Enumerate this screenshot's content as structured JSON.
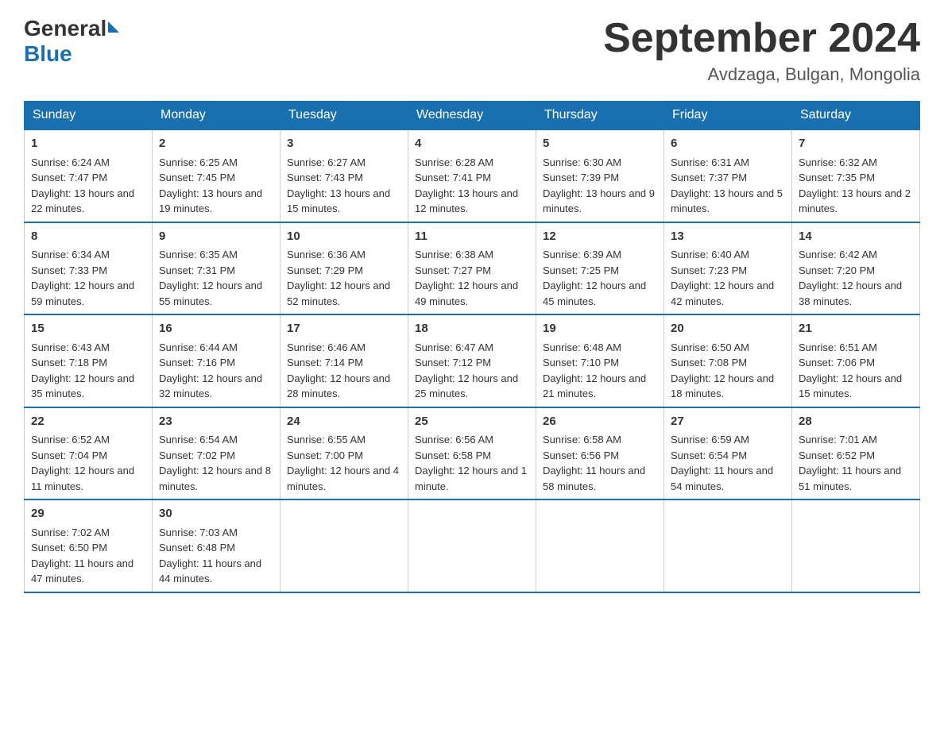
{
  "logo": {
    "general": "General",
    "blue": "Blue"
  },
  "title": "September 2024",
  "location": "Avdzaga, Bulgan, Mongolia",
  "days_of_week": [
    "Sunday",
    "Monday",
    "Tuesday",
    "Wednesday",
    "Thursday",
    "Friday",
    "Saturday"
  ],
  "weeks": [
    [
      {
        "day": "1",
        "sunrise": "Sunrise: 6:24 AM",
        "sunset": "Sunset: 7:47 PM",
        "daylight": "Daylight: 13 hours and 22 minutes."
      },
      {
        "day": "2",
        "sunrise": "Sunrise: 6:25 AM",
        "sunset": "Sunset: 7:45 PM",
        "daylight": "Daylight: 13 hours and 19 minutes."
      },
      {
        "day": "3",
        "sunrise": "Sunrise: 6:27 AM",
        "sunset": "Sunset: 7:43 PM",
        "daylight": "Daylight: 13 hours and 15 minutes."
      },
      {
        "day": "4",
        "sunrise": "Sunrise: 6:28 AM",
        "sunset": "Sunset: 7:41 PM",
        "daylight": "Daylight: 13 hours and 12 minutes."
      },
      {
        "day": "5",
        "sunrise": "Sunrise: 6:30 AM",
        "sunset": "Sunset: 7:39 PM",
        "daylight": "Daylight: 13 hours and 9 minutes."
      },
      {
        "day": "6",
        "sunrise": "Sunrise: 6:31 AM",
        "sunset": "Sunset: 7:37 PM",
        "daylight": "Daylight: 13 hours and 5 minutes."
      },
      {
        "day": "7",
        "sunrise": "Sunrise: 6:32 AM",
        "sunset": "Sunset: 7:35 PM",
        "daylight": "Daylight: 13 hours and 2 minutes."
      }
    ],
    [
      {
        "day": "8",
        "sunrise": "Sunrise: 6:34 AM",
        "sunset": "Sunset: 7:33 PM",
        "daylight": "Daylight: 12 hours and 59 minutes."
      },
      {
        "day": "9",
        "sunrise": "Sunrise: 6:35 AM",
        "sunset": "Sunset: 7:31 PM",
        "daylight": "Daylight: 12 hours and 55 minutes."
      },
      {
        "day": "10",
        "sunrise": "Sunrise: 6:36 AM",
        "sunset": "Sunset: 7:29 PM",
        "daylight": "Daylight: 12 hours and 52 minutes."
      },
      {
        "day": "11",
        "sunrise": "Sunrise: 6:38 AM",
        "sunset": "Sunset: 7:27 PM",
        "daylight": "Daylight: 12 hours and 49 minutes."
      },
      {
        "day": "12",
        "sunrise": "Sunrise: 6:39 AM",
        "sunset": "Sunset: 7:25 PM",
        "daylight": "Daylight: 12 hours and 45 minutes."
      },
      {
        "day": "13",
        "sunrise": "Sunrise: 6:40 AM",
        "sunset": "Sunset: 7:23 PM",
        "daylight": "Daylight: 12 hours and 42 minutes."
      },
      {
        "day": "14",
        "sunrise": "Sunrise: 6:42 AM",
        "sunset": "Sunset: 7:20 PM",
        "daylight": "Daylight: 12 hours and 38 minutes."
      }
    ],
    [
      {
        "day": "15",
        "sunrise": "Sunrise: 6:43 AM",
        "sunset": "Sunset: 7:18 PM",
        "daylight": "Daylight: 12 hours and 35 minutes."
      },
      {
        "day": "16",
        "sunrise": "Sunrise: 6:44 AM",
        "sunset": "Sunset: 7:16 PM",
        "daylight": "Daylight: 12 hours and 32 minutes."
      },
      {
        "day": "17",
        "sunrise": "Sunrise: 6:46 AM",
        "sunset": "Sunset: 7:14 PM",
        "daylight": "Daylight: 12 hours and 28 minutes."
      },
      {
        "day": "18",
        "sunrise": "Sunrise: 6:47 AM",
        "sunset": "Sunset: 7:12 PM",
        "daylight": "Daylight: 12 hours and 25 minutes."
      },
      {
        "day": "19",
        "sunrise": "Sunrise: 6:48 AM",
        "sunset": "Sunset: 7:10 PM",
        "daylight": "Daylight: 12 hours and 21 minutes."
      },
      {
        "day": "20",
        "sunrise": "Sunrise: 6:50 AM",
        "sunset": "Sunset: 7:08 PM",
        "daylight": "Daylight: 12 hours and 18 minutes."
      },
      {
        "day": "21",
        "sunrise": "Sunrise: 6:51 AM",
        "sunset": "Sunset: 7:06 PM",
        "daylight": "Daylight: 12 hours and 15 minutes."
      }
    ],
    [
      {
        "day": "22",
        "sunrise": "Sunrise: 6:52 AM",
        "sunset": "Sunset: 7:04 PM",
        "daylight": "Daylight: 12 hours and 11 minutes."
      },
      {
        "day": "23",
        "sunrise": "Sunrise: 6:54 AM",
        "sunset": "Sunset: 7:02 PM",
        "daylight": "Daylight: 12 hours and 8 minutes."
      },
      {
        "day": "24",
        "sunrise": "Sunrise: 6:55 AM",
        "sunset": "Sunset: 7:00 PM",
        "daylight": "Daylight: 12 hours and 4 minutes."
      },
      {
        "day": "25",
        "sunrise": "Sunrise: 6:56 AM",
        "sunset": "Sunset: 6:58 PM",
        "daylight": "Daylight: 12 hours and 1 minute."
      },
      {
        "day": "26",
        "sunrise": "Sunrise: 6:58 AM",
        "sunset": "Sunset: 6:56 PM",
        "daylight": "Daylight: 11 hours and 58 minutes."
      },
      {
        "day": "27",
        "sunrise": "Sunrise: 6:59 AM",
        "sunset": "Sunset: 6:54 PM",
        "daylight": "Daylight: 11 hours and 54 minutes."
      },
      {
        "day": "28",
        "sunrise": "Sunrise: 7:01 AM",
        "sunset": "Sunset: 6:52 PM",
        "daylight": "Daylight: 11 hours and 51 minutes."
      }
    ],
    [
      {
        "day": "29",
        "sunrise": "Sunrise: 7:02 AM",
        "sunset": "Sunset: 6:50 PM",
        "daylight": "Daylight: 11 hours and 47 minutes."
      },
      {
        "day": "30",
        "sunrise": "Sunrise: 7:03 AM",
        "sunset": "Sunset: 6:48 PM",
        "daylight": "Daylight: 11 hours and 44 minutes."
      },
      null,
      null,
      null,
      null,
      null
    ]
  ]
}
